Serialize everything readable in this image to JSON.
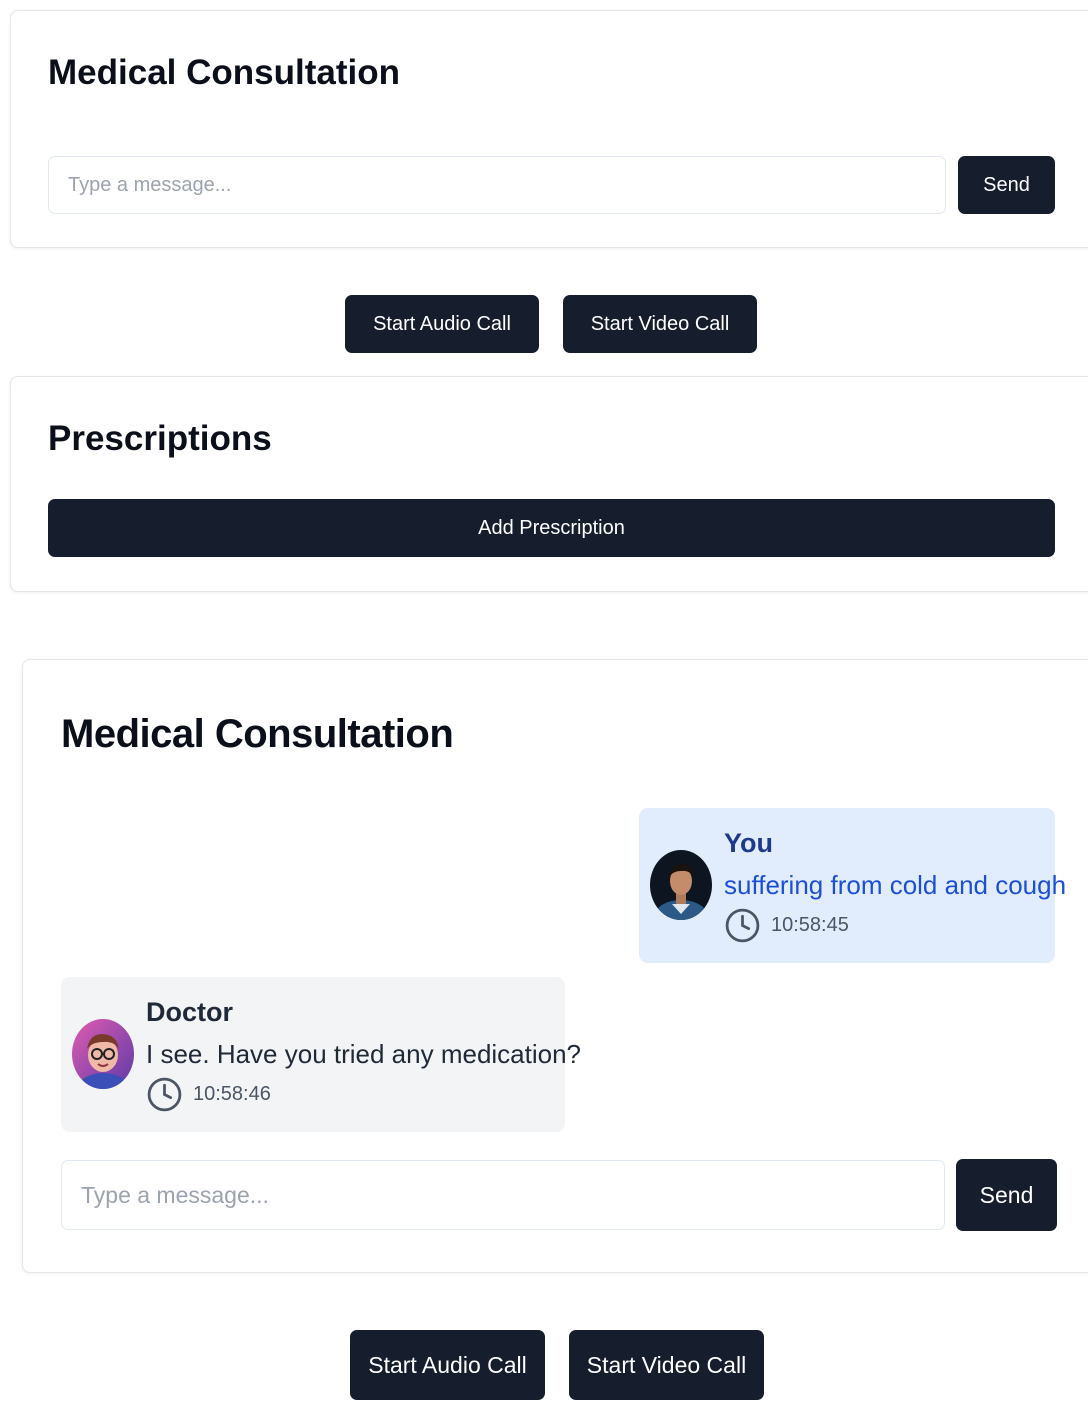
{
  "consultation_top": {
    "title": "Medical Consultation",
    "input_placeholder": "Type a message...",
    "send_label": "Send"
  },
  "calls_top": {
    "audio_label": "Start Audio Call",
    "video_label": "Start Video Call"
  },
  "prescriptions": {
    "title": "Prescriptions",
    "add_label": "Add Prescription"
  },
  "consultation_bottom": {
    "title": "Medical Consultation",
    "messages": [
      {
        "sender": "You",
        "text": "suffering from cold and cough",
        "time": "10:58:45",
        "icon": "clock-icon"
      },
      {
        "sender": "Doctor",
        "text": "I see. Have you tried any medication?",
        "time": "10:58:46",
        "icon": "clock-icon"
      }
    ],
    "input_placeholder": "Type a message...",
    "send_label": "Send"
  },
  "calls_bottom": {
    "audio_label": "Start Audio Call",
    "video_label": "Start Video Call"
  },
  "colors": {
    "button_bg": "#161d2c",
    "user_bubble_bg": "#e1edfd",
    "doctor_bubble_bg": "#f3f4f6",
    "user_name": "#1e3a8a",
    "user_text": "#1d4ed8"
  }
}
